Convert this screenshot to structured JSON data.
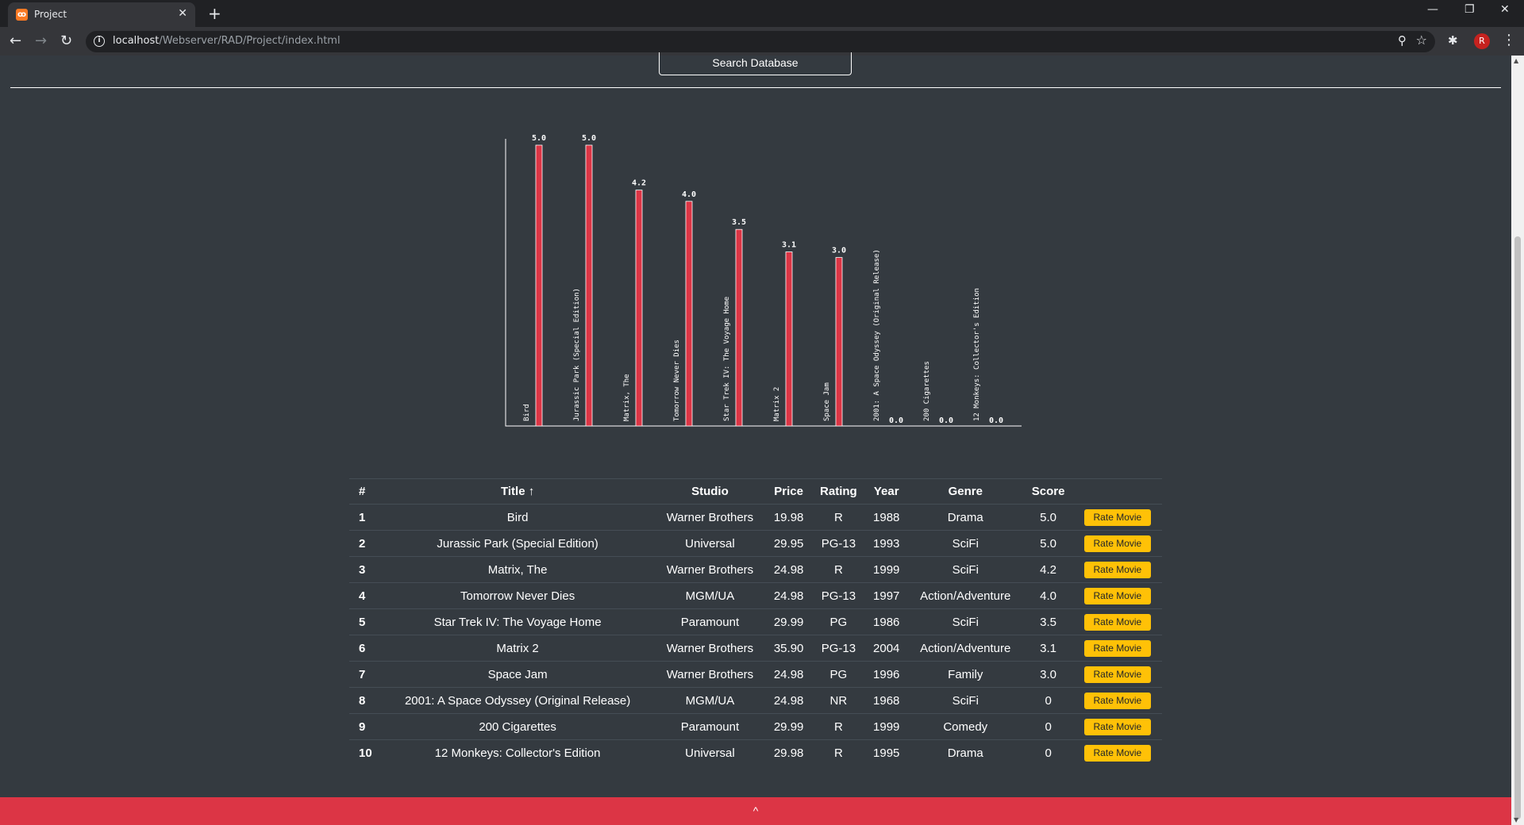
{
  "browser": {
    "tab_title": "Project",
    "tab_favicon": "xampp-favicon-icon",
    "url_host": "localhost",
    "url_path": "/Webserver/RAD/Project/index.html",
    "avatar_letter": "R",
    "back_icon": "←",
    "forward_icon": "→",
    "reload_icon": "↻",
    "new_tab_icon": "+",
    "close_icon": "✕",
    "minimize_icon": "—",
    "restore_icon": "❐",
    "window_close_icon": "✕",
    "zoom_icon": "⚲",
    "star_icon": "☆",
    "extensions_icon": "✱",
    "menu_icon": "⋮"
  },
  "page": {
    "search_button_label": "Search Database",
    "footer_label": "^",
    "accent_color": "#dc3545",
    "button_color": "#ffc107"
  },
  "chart_data": {
    "type": "bar",
    "categories": [
      "Bird",
      "Jurassic Park (Special Edition)",
      "Matrix, The",
      "Tomorrow Never Dies",
      "Star Trek IV: The Voyage Home",
      "Matrix 2",
      "Space Jam",
      "2001: A Space Odyssey (Original Release)",
      "200 Cigarettes",
      "12 Monkeys: Collector's Edition"
    ],
    "values": [
      5.0,
      5.0,
      4.2,
      4.0,
      3.5,
      3.1,
      3.0,
      0.0,
      0.0,
      0.0
    ],
    "value_labels": [
      "5.0",
      "5.0",
      "4.2",
      "4.0",
      "3.5",
      "3.1",
      "3.0",
      "0.0",
      "0.0",
      "0.0"
    ],
    "ylim": [
      0,
      5
    ],
    "bar_color": "#dc3545",
    "grid": false
  },
  "table": {
    "headers": [
      "#",
      "Title ↑",
      "Studio",
      "Price",
      "Rating",
      "Year",
      "Genre",
      "Score"
    ],
    "action_label": "Rate Movie",
    "rows": [
      {
        "n": "1",
        "title": "Bird",
        "studio": "Warner Brothers",
        "price": "19.98",
        "rating": "R",
        "year": "1988",
        "genre": "Drama",
        "score": "5.0"
      },
      {
        "n": "2",
        "title": "Jurassic Park (Special Edition)",
        "studio": "Universal",
        "price": "29.95",
        "rating": "PG-13",
        "year": "1993",
        "genre": "SciFi",
        "score": "5.0"
      },
      {
        "n": "3",
        "title": "Matrix, The",
        "studio": "Warner Brothers",
        "price": "24.98",
        "rating": "R",
        "year": "1999",
        "genre": "SciFi",
        "score": "4.2"
      },
      {
        "n": "4",
        "title": "Tomorrow Never Dies",
        "studio": "MGM/UA",
        "price": "24.98",
        "rating": "PG-13",
        "year": "1997",
        "genre": "Action/Adventure",
        "score": "4.0"
      },
      {
        "n": "5",
        "title": "Star Trek IV: The Voyage Home",
        "studio": "Paramount",
        "price": "29.99",
        "rating": "PG",
        "year": "1986",
        "genre": "SciFi",
        "score": "3.5"
      },
      {
        "n": "6",
        "title": "Matrix 2",
        "studio": "Warner Brothers",
        "price": "35.90",
        "rating": "PG-13",
        "year": "2004",
        "genre": "Action/Adventure",
        "score": "3.1"
      },
      {
        "n": "7",
        "title": "Space Jam",
        "studio": "Warner Brothers",
        "price": "24.98",
        "rating": "PG",
        "year": "1996",
        "genre": "Family",
        "score": "3.0"
      },
      {
        "n": "8",
        "title": "2001: A Space Odyssey (Original Release)",
        "studio": "MGM/UA",
        "price": "24.98",
        "rating": "NR",
        "year": "1968",
        "genre": "SciFi",
        "score": "0"
      },
      {
        "n": "9",
        "title": "200 Cigarettes",
        "studio": "Paramount",
        "price": "29.99",
        "rating": "R",
        "year": "1999",
        "genre": "Comedy",
        "score": "0"
      },
      {
        "n": "10",
        "title": "12 Monkeys: Collector's Edition",
        "studio": "Universal",
        "price": "29.98",
        "rating": "R",
        "year": "1995",
        "genre": "Drama",
        "score": "0"
      }
    ]
  }
}
